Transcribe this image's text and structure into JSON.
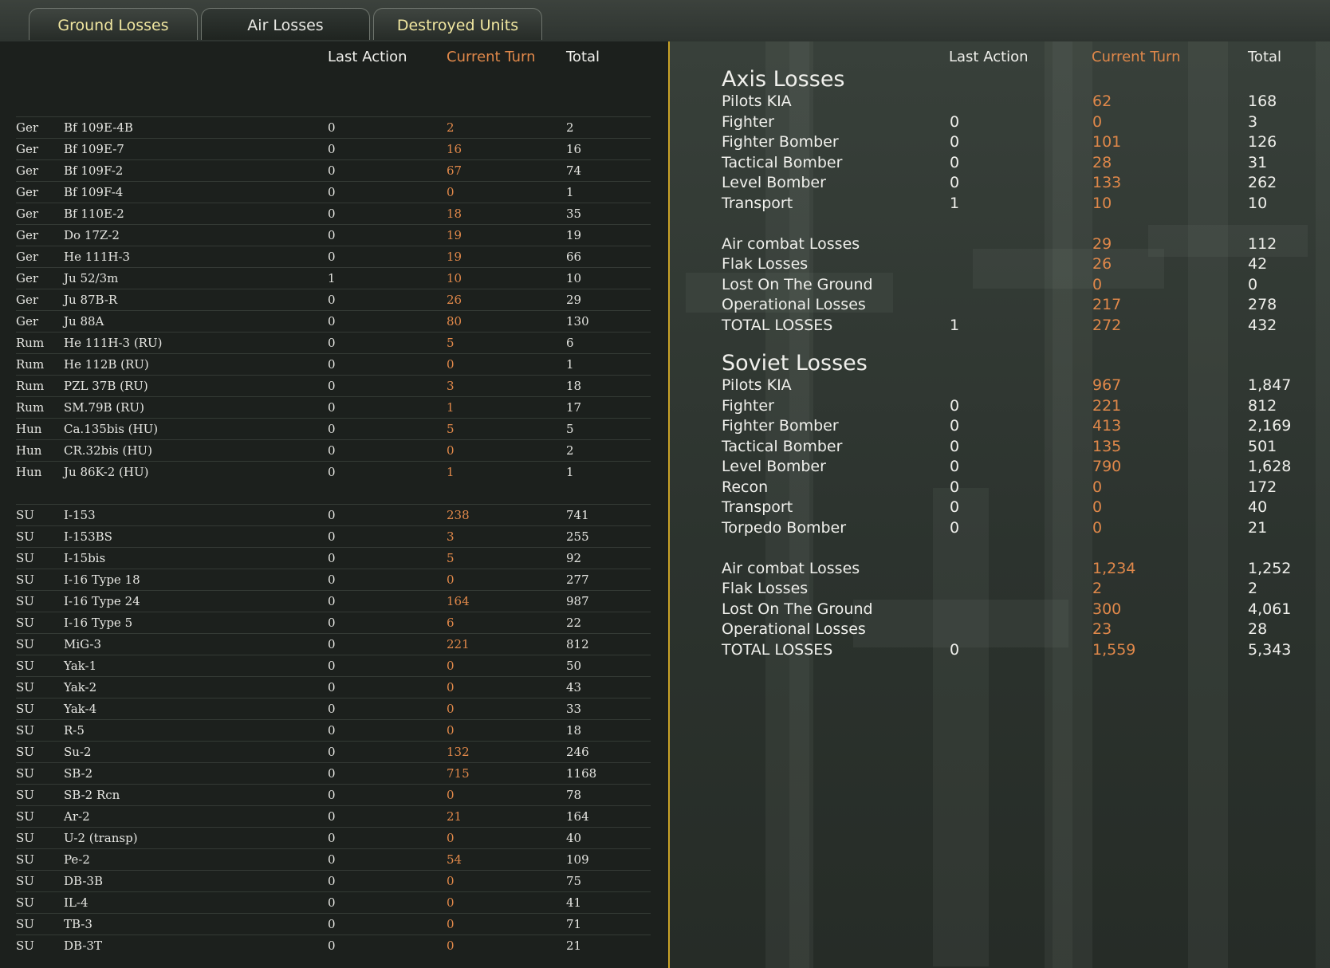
{
  "tabs": [
    {
      "label": "Ground Losses"
    },
    {
      "label": "Air Losses"
    },
    {
      "label": "Destroyed Units"
    }
  ],
  "colors": {
    "accent": "#c9a227",
    "current_turn": "#e0884a",
    "tab_text_active": "#f0e6a0"
  },
  "left": {
    "headers": {
      "last_action": "Last Action",
      "current_turn": "Current Turn",
      "total": "Total"
    },
    "axis_rows": [
      {
        "nat": "Ger",
        "plane": "Bf 109E-4B",
        "la": "0",
        "ct": "2",
        "to": "2"
      },
      {
        "nat": "Ger",
        "plane": "Bf 109E-7",
        "la": "0",
        "ct": "16",
        "to": "16"
      },
      {
        "nat": "Ger",
        "plane": "Bf 109F-2",
        "la": "0",
        "ct": "67",
        "to": "74"
      },
      {
        "nat": "Ger",
        "plane": "Bf 109F-4",
        "la": "0",
        "ct": "0",
        "to": "1"
      },
      {
        "nat": "Ger",
        "plane": "Bf 110E-2",
        "la": "0",
        "ct": "18",
        "to": "35"
      },
      {
        "nat": "Ger",
        "plane": "Do 17Z-2",
        "la": "0",
        "ct": "19",
        "to": "19"
      },
      {
        "nat": "Ger",
        "plane": "He 111H-3",
        "la": "0",
        "ct": "19",
        "to": "66"
      },
      {
        "nat": "Ger",
        "plane": "Ju 52/3m",
        "la": "1",
        "ct": "10",
        "to": "10"
      },
      {
        "nat": "Ger",
        "plane": "Ju 87B-R",
        "la": "0",
        "ct": "26",
        "to": "29"
      },
      {
        "nat": "Ger",
        "plane": "Ju 88A",
        "la": "0",
        "ct": "80",
        "to": "130"
      },
      {
        "nat": "Rum",
        "plane": "He 111H-3 (RU)",
        "la": "0",
        "ct": "5",
        "to": "6"
      },
      {
        "nat": "Rum",
        "plane": "He 112B (RU)",
        "la": "0",
        "ct": "0",
        "to": "1"
      },
      {
        "nat": "Rum",
        "plane": "PZL 37B (RU)",
        "la": "0",
        "ct": "3",
        "to": "18"
      },
      {
        "nat": "Rum",
        "plane": "SM.79B (RU)",
        "la": "0",
        "ct": "1",
        "to": "17"
      },
      {
        "nat": "Hun",
        "plane": "Ca.135bis (HU)",
        "la": "0",
        "ct": "5",
        "to": "5"
      },
      {
        "nat": "Hun",
        "plane": "CR.32bis (HU)",
        "la": "0",
        "ct": "0",
        "to": "2"
      },
      {
        "nat": "Hun",
        "plane": "Ju 86K-2 (HU)",
        "la": "0",
        "ct": "1",
        "to": "1"
      }
    ],
    "soviet_rows": [
      {
        "nat": "SU",
        "plane": "I-153",
        "la": "0",
        "ct": "238",
        "to": "741"
      },
      {
        "nat": "SU",
        "plane": "I-153BS",
        "la": "0",
        "ct": "3",
        "to": "255"
      },
      {
        "nat": "SU",
        "plane": "I-15bis",
        "la": "0",
        "ct": "5",
        "to": "92"
      },
      {
        "nat": "SU",
        "plane": "I-16 Type 18",
        "la": "0",
        "ct": "0",
        "to": "277"
      },
      {
        "nat": "SU",
        "plane": "I-16 Type 24",
        "la": "0",
        "ct": "164",
        "to": "987"
      },
      {
        "nat": "SU",
        "plane": "I-16 Type 5",
        "la": "0",
        "ct": "6",
        "to": "22"
      },
      {
        "nat": "SU",
        "plane": "MiG-3",
        "la": "0",
        "ct": "221",
        "to": "812"
      },
      {
        "nat": "SU",
        "plane": "Yak-1",
        "la": "0",
        "ct": "0",
        "to": "50"
      },
      {
        "nat": "SU",
        "plane": "Yak-2",
        "la": "0",
        "ct": "0",
        "to": "43"
      },
      {
        "nat": "SU",
        "plane": "Yak-4",
        "la": "0",
        "ct": "0",
        "to": "33"
      },
      {
        "nat": "SU",
        "plane": "R-5",
        "la": "0",
        "ct": "0",
        "to": "18"
      },
      {
        "nat": "SU",
        "plane": "Su-2",
        "la": "0",
        "ct": "132",
        "to": "246"
      },
      {
        "nat": "SU",
        "plane": "SB-2",
        "la": "0",
        "ct": "715",
        "to": "1168"
      },
      {
        "nat": "SU",
        "plane": "SB-2 Rcn",
        "la": "0",
        "ct": "0",
        "to": "78"
      },
      {
        "nat": "SU",
        "plane": "Ar-2",
        "la": "0",
        "ct": "21",
        "to": "164"
      },
      {
        "nat": "SU",
        "plane": "U-2 (transp)",
        "la": "0",
        "ct": "0",
        "to": "40"
      },
      {
        "nat": "SU",
        "plane": "Pe-2",
        "la": "0",
        "ct": "54",
        "to": "109"
      },
      {
        "nat": "SU",
        "plane": "DB-3B",
        "la": "0",
        "ct": "0",
        "to": "75"
      },
      {
        "nat": "SU",
        "plane": "IL-4",
        "la": "0",
        "ct": "0",
        "to": "41"
      },
      {
        "nat": "SU",
        "plane": "TB-3",
        "la": "0",
        "ct": "0",
        "to": "71"
      },
      {
        "nat": "SU",
        "plane": "DB-3T",
        "la": "0",
        "ct": "0",
        "to": "21"
      }
    ]
  },
  "right": {
    "headers": {
      "last_action": "Last Action",
      "current_turn": "Current Turn",
      "total": "Total"
    },
    "axis": {
      "title": "Axis Losses",
      "types": [
        {
          "label": "Pilots KIA",
          "la": "",
          "ct": "62",
          "to": "168"
        },
        {
          "label": "Fighter",
          "la": "0",
          "ct": "0",
          "to": "3"
        },
        {
          "label": "Fighter Bomber",
          "la": "0",
          "ct": "101",
          "to": "126"
        },
        {
          "label": "Tactical Bomber",
          "la": "0",
          "ct": "28",
          "to": "31"
        },
        {
          "label": "Level Bomber",
          "la": "0",
          "ct": "133",
          "to": "262"
        },
        {
          "label": "Transport",
          "la": "1",
          "ct": "10",
          "to": "10"
        }
      ],
      "causes": [
        {
          "label": "Air combat Losses",
          "la": "",
          "ct": "29",
          "to": "112"
        },
        {
          "label": "Flak Losses",
          "la": "",
          "ct": "26",
          "to": "42"
        },
        {
          "label": "Lost On The Ground",
          "la": "",
          "ct": "0",
          "to": "0"
        },
        {
          "label": "Operational Losses",
          "la": "",
          "ct": "217",
          "to": "278"
        },
        {
          "label": "TOTAL LOSSES",
          "la": "1",
          "ct": "272",
          "to": "432"
        }
      ]
    },
    "soviet": {
      "title": "Soviet Losses",
      "types": [
        {
          "label": "Pilots KIA",
          "la": "",
          "ct": "967",
          "to": "1,847"
        },
        {
          "label": "Fighter",
          "la": "0",
          "ct": "221",
          "to": "812"
        },
        {
          "label": "Fighter Bomber",
          "la": "0",
          "ct": "413",
          "to": "2,169"
        },
        {
          "label": "Tactical Bomber",
          "la": "0",
          "ct": "135",
          "to": "501"
        },
        {
          "label": "Level Bomber",
          "la": "0",
          "ct": "790",
          "to": "1,628"
        },
        {
          "label": "Recon",
          "la": "0",
          "ct": "0",
          "to": "172"
        },
        {
          "label": "Transport",
          "la": "0",
          "ct": "0",
          "to": "40"
        },
        {
          "label": "Torpedo Bomber",
          "la": "0",
          "ct": "0",
          "to": "21"
        }
      ],
      "causes": [
        {
          "label": "Air combat Losses",
          "la": "",
          "ct": "1,234",
          "to": "1,252"
        },
        {
          "label": "Flak Losses",
          "la": "",
          "ct": "2",
          "to": "2"
        },
        {
          "label": "Lost On The Ground",
          "la": "",
          "ct": "300",
          "to": "4,061"
        },
        {
          "label": "Operational Losses",
          "la": "",
          "ct": "23",
          "to": "28"
        },
        {
          "label": "TOTAL LOSSES",
          "la": "0",
          "ct": "1,559",
          "to": "5,343"
        }
      ]
    }
  }
}
